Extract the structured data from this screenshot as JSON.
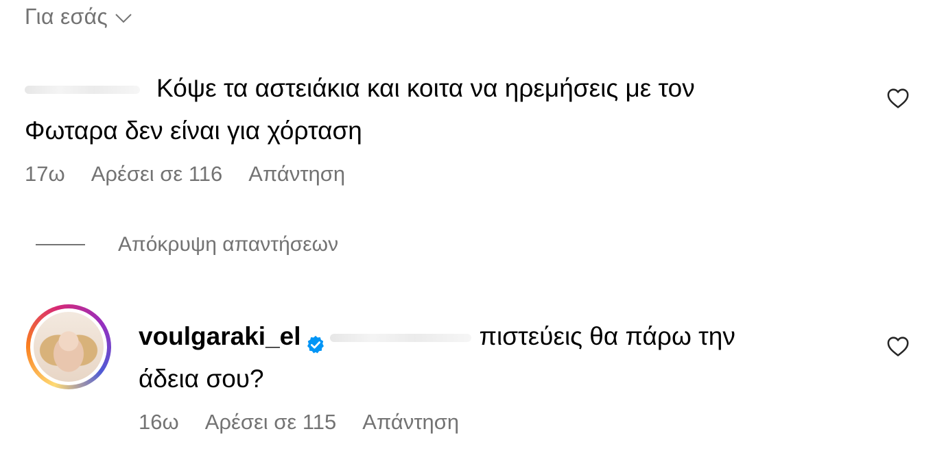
{
  "sort": {
    "label": "Για εσάς",
    "icon": "chevron-down-icon"
  },
  "comments": [
    {
      "text_line1": "Κόψε τα αστειάκια και κοιτα να ηρεμήσεις με τον",
      "text_line2": "Φωταρα δεν είναι για χόρταση",
      "age": "17ω",
      "likes": "Αρέσει σε 116",
      "reply": "Απάντηση",
      "like_icon": "heart-icon"
    }
  ],
  "hide_replies": {
    "label": "Απόκρυψη απαντήσεων"
  },
  "reply_comment": {
    "username": "voulgaraki_el",
    "verified_icon": "verified-badge-icon",
    "text_line1": "πιστεύεις θα πάρω την",
    "text_line2": "άδεια σου?",
    "age": "16ω",
    "likes": "Αρέσει σε 115",
    "reply": "Απάντηση",
    "like_icon": "heart-icon"
  },
  "colors": {
    "secondary_text": "#737373",
    "verified_blue": "#0095f6"
  }
}
